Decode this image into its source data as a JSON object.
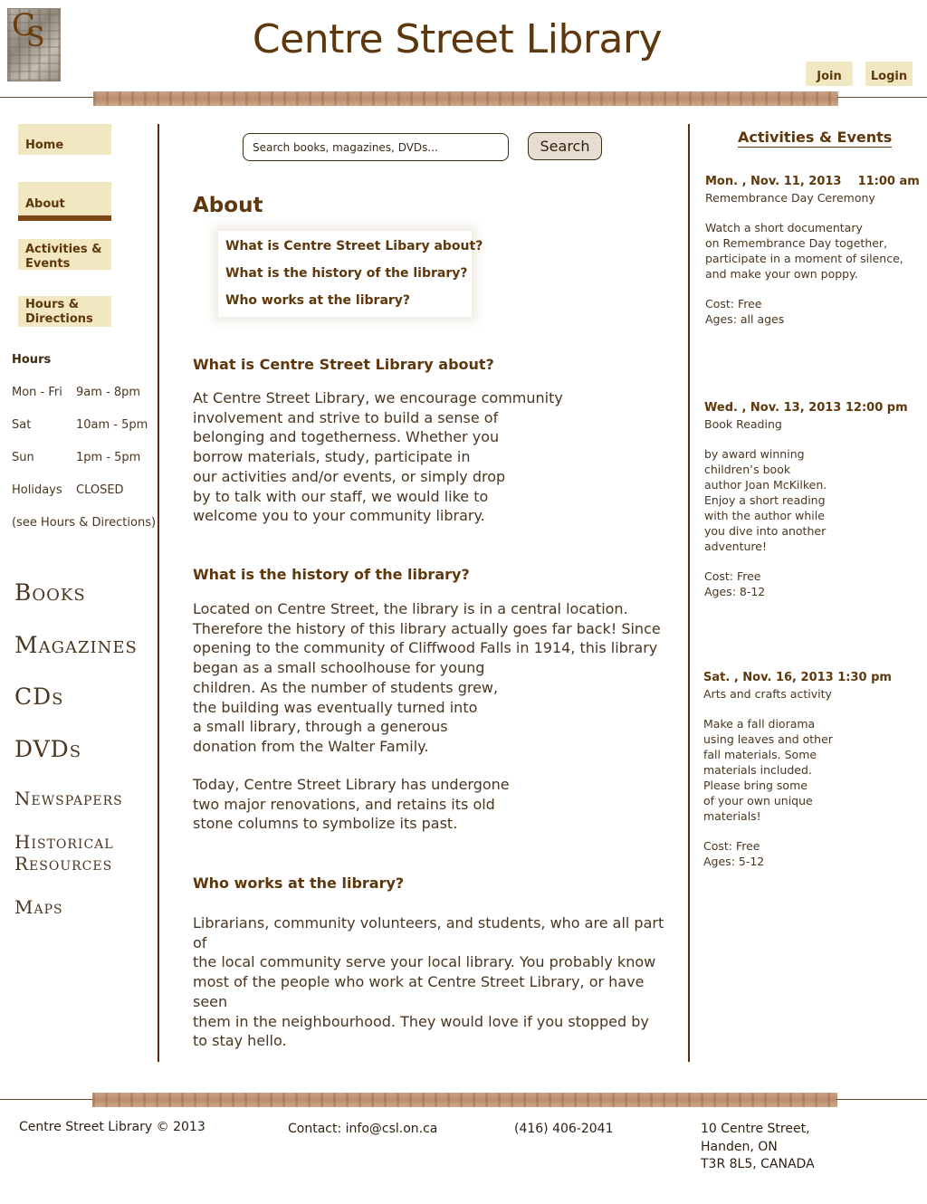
{
  "header": {
    "logo_text": "CS",
    "title": "Centre Street Library",
    "join_label": "Join",
    "login_label": "Login"
  },
  "nav": {
    "home": "Home",
    "about": "About",
    "activities": "Activities &\nEvents",
    "hours_directions": "Hours &\nDirections"
  },
  "hours": {
    "heading": "Hours",
    "rows": [
      {
        "day": "Mon - Fri",
        "time": "9am - 8pm"
      },
      {
        "day": "Sat",
        "time": "10am - 5pm"
      },
      {
        "day": "Sun",
        "time": "1pm - 5pm"
      },
      {
        "day": "Holidays",
        "time": "CLOSED"
      }
    ],
    "see_more": "(see Hours & Directions)"
  },
  "categories": [
    "Books",
    "Magazines",
    "CDs",
    "DVDs",
    "Newspapers",
    "Historical Resources",
    "Maps"
  ],
  "search": {
    "placeholder": "Search books, magazines, DVDs...",
    "button": "Search"
  },
  "main": {
    "title": "About",
    "toc": [
      "What is Centre Street Libary about?",
      "What is the history of the library?",
      "Who works at the library?"
    ],
    "sections": [
      {
        "heading": "What is Centre Street Library about?",
        "body": "At Centre Street Library, we encourage community\ninvolvement and strive to build a sense of\nbelonging and togetherness. Whether you\nborrow materials, study, participate in\nour activities and/or events, or simply drop\nby to talk with our staff, we would like to\nwelcome you to your community library."
      },
      {
        "heading": "What is the history of the library?",
        "body": "Located on Centre Street, the library is in a central location.\nTherefore the history of this library actually goes far back! Since\nopening to the community of Cliffwood Falls in 1914, this library\nbegan as a small schoolhouse for young\nchildren. As the number of  students grew,\nthe building was eventually turned into\na small library, through a generous\ndonation from the Walter Family.",
        "body2": "Today, Centre Street Library has undergone\ntwo major renovations, and retains its old\nstone columns to symbolize its past."
      },
      {
        "heading": "Who works at the library?",
        "body": "Librarians, community volunteers, and students, who are all part of\nthe local community serve your local library. You probably know\nmost of the people who work at Centre Street Library, or have seen\nthem in the neighbourhood. They would love if you stopped by\nto stay hello."
      }
    ]
  },
  "events": {
    "title": "Activities & Events",
    "items": [
      {
        "date": "Mon. , Nov. 11, 2013    11:00 am",
        "name": "Remembrance Day Ceremony",
        "desc": "Watch a short documentary\non Remembrance Day together,\nparticipate in a moment of silence,\nand make your own poppy.",
        "cost": "Cost: Free",
        "ages": "Ages: all ages"
      },
      {
        "date": "Wed. , Nov. 13, 2013 12:00 pm",
        "name": "Book Reading",
        "desc": "by award winning\nchildren’s book\nauthor Joan McKilken.\nEnjoy a short reading\nwith the author while\nyou dive into another\nadventure!",
        "cost": "Cost: Free",
        "ages": "Ages: 8-12"
      },
      {
        "date": "Sat. , Nov. 16, 2013 1:30 pm",
        "name": "Arts and crafts activity",
        "desc": "Make a fall diorama\nusing leaves and other\nfall materials. Some\nmaterials included.\nPlease bring some\nof your own unique\nmaterials!",
        "cost": "Cost: Free",
        "ages": "Ages: 5-12"
      }
    ]
  },
  "footer": {
    "copyright": "Centre Street Library © 2013",
    "contact": "Contact: info@csl.on.ca",
    "phone": "(416) 406-2041",
    "address": "10 Centre Street,\nHanden, ON\nT3R 8L5, CANADA"
  }
}
